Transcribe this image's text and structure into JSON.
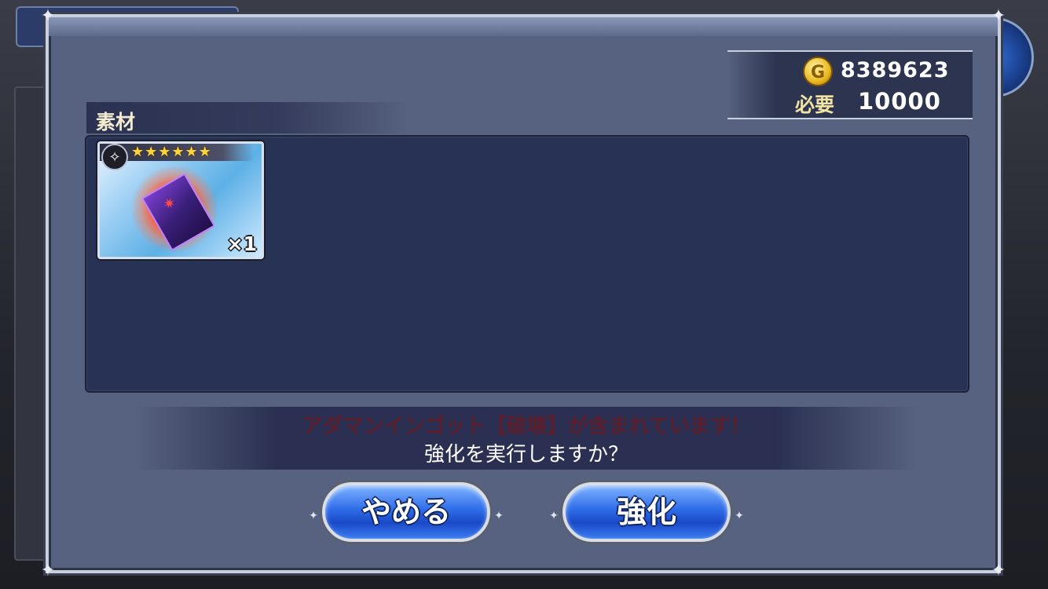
{
  "gold": {
    "icon": "gold-coin-icon",
    "icon_letter": "G",
    "current": "8389623",
    "required_label": "必要",
    "required": "10000"
  },
  "materials": {
    "title": "素材",
    "items": [
      {
        "name": "アダマンインゴット【破壊】",
        "rarity_stars": "★★★★★★",
        "count": "×1",
        "icon": "adamantite-ingot-icon"
      }
    ]
  },
  "message": {
    "warning": "アダマンインゴット【破壊】が含まれています！",
    "confirm": "強化を実行しますか？"
  },
  "buttons": {
    "cancel": "やめる",
    "enhance": "強化"
  },
  "colors": {
    "dialog_bg": "#56627f",
    "panel_bg": "#283254",
    "button_blue": "#2f6de8",
    "gold": "#e9b820",
    "warning_text": "#5b1e2c"
  }
}
